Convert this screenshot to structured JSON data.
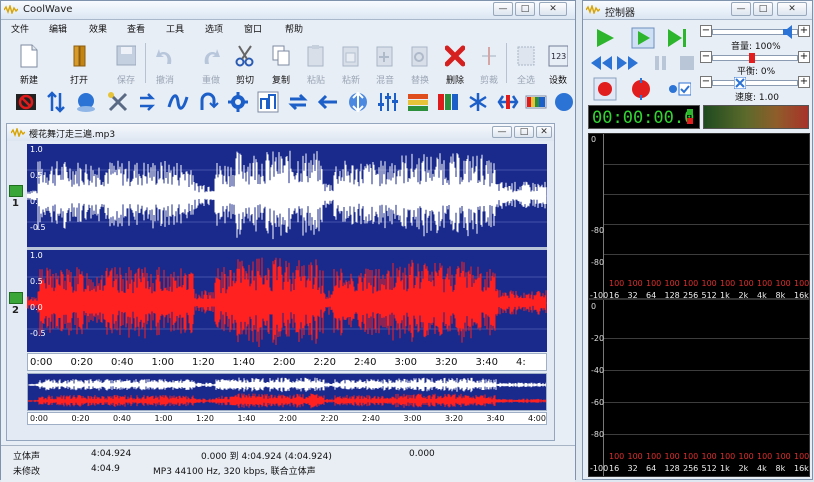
{
  "main_window": {
    "title": "CoolWave",
    "controls": {
      "minimize": "—",
      "maximize": "□",
      "close": "✕"
    }
  },
  "menu": {
    "items": [
      "文件",
      "编辑",
      "效果",
      "查看",
      "工具",
      "选项",
      "窗口",
      "帮助"
    ]
  },
  "toolbar": {
    "buttons": [
      {
        "label": "新建",
        "icon": "new-file-icon",
        "enabled": true
      },
      {
        "label": "打开",
        "icon": "open-folder-icon",
        "enabled": true
      },
      {
        "label": "保存",
        "icon": "save-icon",
        "enabled": false
      },
      {
        "label": "撤消",
        "icon": "undo-icon",
        "enabled": false
      },
      {
        "label": "重做",
        "icon": "redo-icon",
        "enabled": false
      },
      {
        "label": "剪切",
        "icon": "cut-icon",
        "enabled": true
      },
      {
        "label": "复制",
        "icon": "copy-icon",
        "enabled": true
      },
      {
        "label": "粘贴",
        "icon": "paste-icon",
        "enabled": false
      },
      {
        "label": "粘新",
        "icon": "paste-new-icon",
        "enabled": false
      },
      {
        "label": "混音",
        "icon": "mix-icon",
        "enabled": false
      },
      {
        "label": "替换",
        "icon": "replace-icon",
        "enabled": false
      },
      {
        "label": "删除",
        "icon": "delete-icon",
        "enabled": true
      },
      {
        "label": "剪裁",
        "icon": "trim-icon",
        "enabled": false
      },
      {
        "label": "全选",
        "icon": "select-all-icon",
        "enabled": false
      },
      {
        "label": "设数",
        "icon": "set-number-icon",
        "enabled": true
      }
    ]
  },
  "document": {
    "title": "樱花舞汀走三遍.mp3",
    "channel_axis": [
      "1.0",
      "0.5",
      "0.0",
      "-0.5"
    ],
    "channel_numbers": [
      "1",
      "2"
    ],
    "time_ticks": [
      "0:00",
      "0:20",
      "0:40",
      "1:00",
      "1:20",
      "1:40",
      "2:00",
      "2:20",
      "2:40",
      "3:00",
      "3:20",
      "3:40",
      "4:"
    ],
    "overview_ticks": [
      "0:00",
      "0:40",
      "1:20",
      "2:00",
      "2:40",
      "3:20",
      "4:00"
    ],
    "overview_ticks_full": [
      "0:00",
      "0:20",
      "0:40",
      "1:00",
      "1:20",
      "1:40",
      "2:00",
      "2:20",
      "2:40",
      "3:00",
      "3:20",
      "3:40",
      "4:00"
    ]
  },
  "status": {
    "row1": {
      "channel": "立体声",
      "length": "4:04.924",
      "range": "0.000 到 4:04.924 (4:04.924)",
      "sel": "0.000"
    },
    "row2": {
      "state": "未修改",
      "length": "4:04.9",
      "format": "MP3 44100 Hz, 320 kbps, 联合立体声"
    }
  },
  "control_panel": {
    "title": "控制器",
    "controls": {
      "minimize": "—",
      "maximize": "□",
      "close": "✕"
    },
    "volume": {
      "label": "音量: 100%",
      "level": 0.95
    },
    "balance": {
      "label": "平衡: 0%",
      "level": 0.5
    },
    "speed": {
      "label": "速度: 1.00",
      "level": 0.3
    },
    "timer": "00:00:00.0",
    "spectrum_db_top": [
      "0",
      "-80",
      "-80"
    ],
    "spectrum_db_bottom": [
      "0",
      "-20",
      "-40",
      "-60",
      "-80"
    ],
    "freq_left_label": "-100",
    "red_values": [
      "100",
      "100",
      "100",
      "100",
      "100",
      "100",
      "100",
      "100",
      "100",
      "100",
      "100"
    ],
    "freqs": [
      "16",
      "32",
      "64",
      "128",
      "256",
      "512",
      "1k",
      "2k",
      "4k",
      "8k",
      "16k"
    ],
    "colors": {
      "play": "#2db52d",
      "record": "#e11d1d",
      "timer": "#31d431"
    }
  }
}
